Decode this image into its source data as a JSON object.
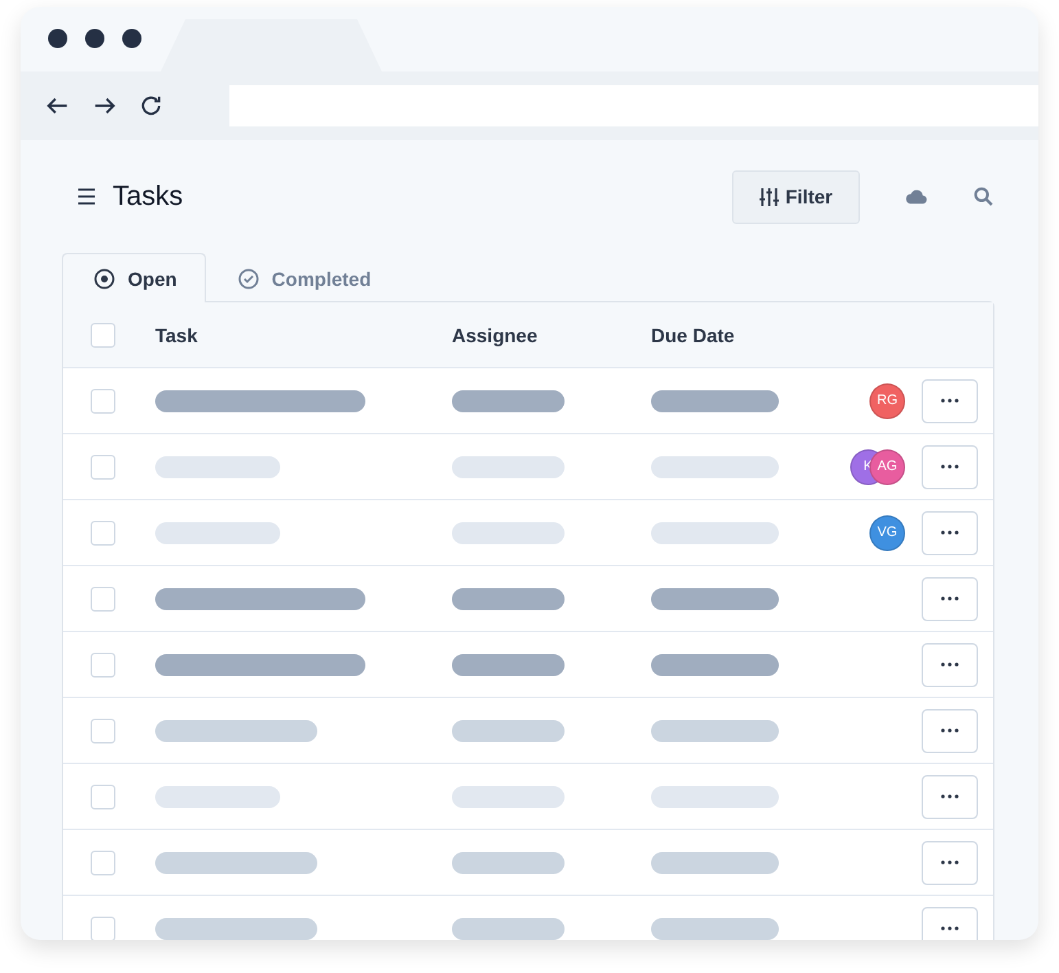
{
  "page": {
    "title": "Tasks"
  },
  "toolbar": {
    "filter_label": "Filter"
  },
  "tabs": [
    {
      "label": "Open",
      "selected": true,
      "kind": "radio"
    },
    {
      "label": "Completed",
      "selected": false,
      "kind": "check"
    }
  ],
  "table": {
    "select_all_checked": false,
    "columns": [
      "Task",
      "Assignee",
      "Due Date"
    ],
    "rows": [
      {
        "checked": false,
        "kind": "dark",
        "avatars": [
          {
            "initials": "RG",
            "color": "#f06262"
          }
        ]
      },
      {
        "checked": false,
        "kind": "light",
        "avatars": [
          {
            "initials": "K",
            "color": "#9f6fe6"
          },
          {
            "initials": "AG",
            "color": "#e85d9f"
          }
        ]
      },
      {
        "checked": false,
        "kind": "light",
        "avatars": [
          {
            "initials": "VG",
            "color": "#3f90e0"
          }
        ]
      },
      {
        "checked": false,
        "kind": "dark"
      },
      {
        "checked": false,
        "kind": "dark"
      },
      {
        "checked": false,
        "kind": "medium"
      },
      {
        "checked": false,
        "kind": "light"
      },
      {
        "checked": false,
        "kind": "medium"
      },
      {
        "checked": false,
        "kind": "medium"
      }
    ]
  }
}
